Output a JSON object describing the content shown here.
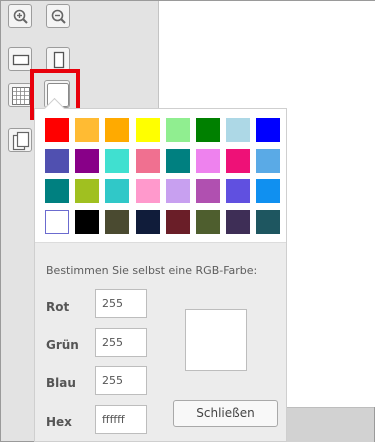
{
  "toolbar": {
    "tools": [
      {
        "name": "zoom-in-icon"
      },
      {
        "name": "zoom-out-icon"
      },
      {
        "name": "landscape-page-icon"
      },
      {
        "name": "portrait-page-icon"
      },
      {
        "name": "grid-icon"
      },
      {
        "name": "background-color-icon"
      },
      {
        "name": "copy-page-icon"
      }
    ]
  },
  "palette": {
    "rows": [
      [
        "#ff0000",
        "#ffbb33",
        "#ffaa00",
        "#ffff00",
        "#90ee90",
        "#008000",
        "#add8e6",
        "#0000ff"
      ],
      [
        "#5050b0",
        "#880088",
        "#40e0d0",
        "#f07090",
        "#008080",
        "#ee82ee",
        "#ee1177",
        "#5aaae6"
      ],
      [
        "#008080",
        "#a0c020",
        "#30c8c8",
        "#ff99cc",
        "#c8a0f0",
        "#b050b0",
        "#6050e0",
        "#1090f0"
      ],
      [
        "#ffffff",
        "#000000",
        "#4a4a30",
        "#101c3a",
        "#6a1e28",
        "#4e5e2e",
        "#3e2e56",
        "#1e5660"
      ]
    ],
    "selected": "#ffffff"
  },
  "rgb": {
    "title": "Bestimmen Sie selbst eine RGB-Farbe:",
    "red_label": "Rot",
    "red_value": "255",
    "green_label": "Grün",
    "green_value": "255",
    "blue_label": "Blau",
    "blue_value": "255",
    "hex_label": "Hex",
    "hex_value": "ffffff",
    "preview_color": "#ffffff"
  },
  "close_label": "Schließen",
  "colors": {
    "highlight": "#e8000b"
  }
}
